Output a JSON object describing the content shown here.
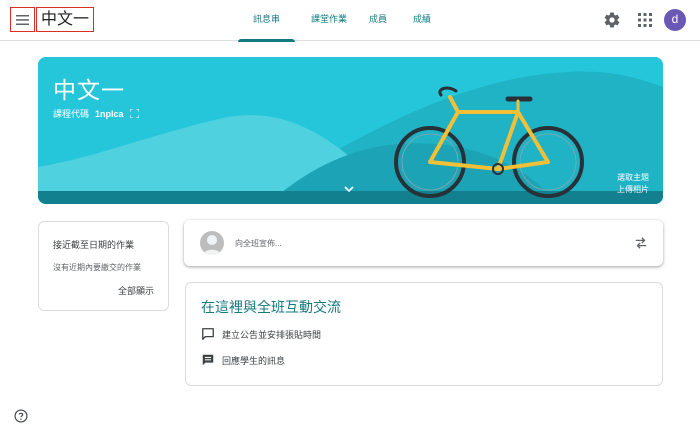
{
  "header": {
    "course_title": "中文一",
    "tabs": [
      {
        "label": "訊息串",
        "active": true
      },
      {
        "label": "課堂作業",
        "active": false
      },
      {
        "label": "成員",
        "active": false
      },
      {
        "label": "成績",
        "active": false
      }
    ],
    "avatar_letter": "d",
    "icons": [
      "menu-icon",
      "gear-icon",
      "apps-grid-icon"
    ]
  },
  "banner": {
    "title": "中文一",
    "code_label": "課程代碼",
    "code_value": "1nplca",
    "select_theme": "選取主題",
    "upload_photo": "上傳相片",
    "color": "#26c6da"
  },
  "upcoming": {
    "heading": "接近截至日期的作業",
    "empty_text": "沒有近期內要繳交的作業",
    "view_all": "全部顯示"
  },
  "compose": {
    "placeholder": "向全班宣佈..."
  },
  "info": {
    "heading": "在這裡與全班互動交流",
    "rows": [
      {
        "icon": "announcement-icon",
        "text": "建立公告並安排張貼時間"
      },
      {
        "icon": "reply-message-icon",
        "text": "回應學生的訊息"
      }
    ]
  },
  "colors": {
    "accent": "#137a7f",
    "avatar": "#6b58b6",
    "banner": "#26c6da",
    "highlight_border": "#d93025"
  }
}
